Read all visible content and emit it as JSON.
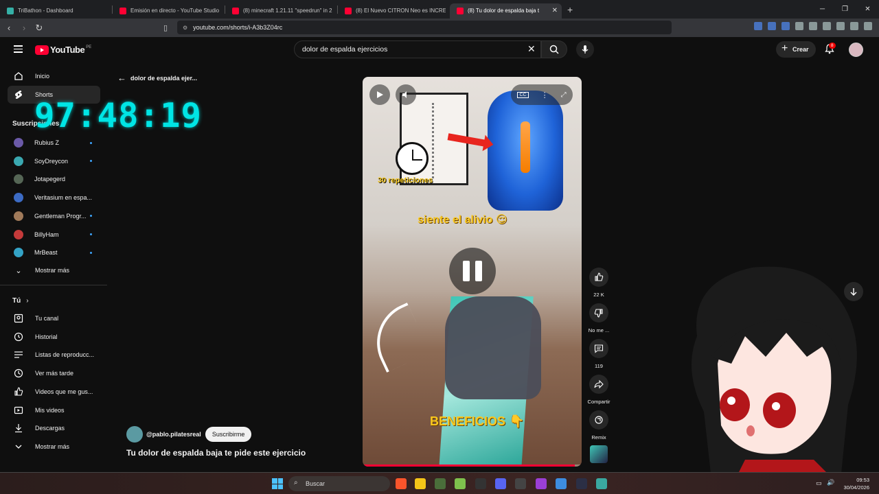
{
  "browser": {
    "tabs": [
      {
        "title": "TriBathon - Dashboard",
        "color": "#35b0a6"
      },
      {
        "title": "Emisión en directo - YouTube Studio",
        "color": "#ff0033"
      },
      {
        "title": "(8) minecraft 1.21.11 \"speedrun\" in 2",
        "color": "#ff0033"
      },
      {
        "title": "(8) El Nuevo CITRON Neo es INCREIB",
        "color": "#ff0033"
      },
      {
        "title": "(8) Tu dolor de espalda baja t",
        "color": "#ff0033",
        "active": true
      }
    ],
    "url": "youtube.com/shorts/i-A3b3Z04rc"
  },
  "header": {
    "logo_text": "YouTube",
    "country_code": "PE",
    "search_value": "dolor de espalda ejercicios",
    "create_label": "Crear",
    "notifications_count": "8"
  },
  "sidebar": {
    "main": [
      {
        "label": "Inicio",
        "icon": "home-icon"
      },
      {
        "label": "Shorts",
        "icon": "shorts-icon",
        "active": true
      }
    ],
    "subscriptions_title": "Suscripciones",
    "subscriptions": [
      {
        "label": "Rubius Z",
        "color": "#6b5aa8",
        "live_dot": true
      },
      {
        "label": "SoyDreycon",
        "color": "#3aa8b0",
        "live_dot": true
      },
      {
        "label": "Jotapegerd",
        "color": "#556655",
        "live_dot": false
      },
      {
        "label": "Veritasium en espa...",
        "color": "#3c6bc4",
        "live_dot": false
      },
      {
        "label": "Gentleman Progr...",
        "color": "#a07a5a",
        "live_dot": true
      },
      {
        "label": "BillyHam",
        "color": "#c43a3a",
        "live_dot": true
      },
      {
        "label": "MrBeast",
        "color": "#34a3c6",
        "live_dot": true
      }
    ],
    "show_more": "Mostrar más",
    "you_title": "Tú",
    "you_items": [
      {
        "label": "Tu canal",
        "icon": "channel-icon"
      },
      {
        "label": "Historial",
        "icon": "history-icon"
      },
      {
        "label": "Listas de reproducc...",
        "icon": "playlists-icon"
      },
      {
        "label": "Ver más tarde",
        "icon": "watch-later-icon"
      },
      {
        "label": "Videos que me gus...",
        "icon": "liked-icon"
      },
      {
        "label": "Mis videos",
        "icon": "my-videos-icon"
      },
      {
        "label": "Descargas",
        "icon": "downloads-icon"
      },
      {
        "label": "Mostrar más",
        "icon": "chevron-down-icon"
      }
    ]
  },
  "overlay_timer": "97:48:19",
  "shorts": {
    "back_label": "dolor de espalda ejer...",
    "channel_handle": "@pablo.pilatesreal",
    "subscribe_label": "Suscribirme",
    "title": "Tu dolor de espalda baja te pide este ejercicio",
    "video_captions": {
      "reps": "30 repeticiones",
      "relief": "siente el alivio 😌",
      "benefits": "BENEFICIOS 👇"
    },
    "progress": 0.97,
    "actions": [
      {
        "label": "22 K",
        "icon": "like-icon"
      },
      {
        "label": "No me ...",
        "icon": "dislike-icon"
      },
      {
        "label": "119",
        "icon": "comment-icon"
      },
      {
        "label": "Compartir",
        "icon": "share-icon"
      },
      {
        "label": "Remix",
        "icon": "remix-icon"
      }
    ]
  },
  "taskbar": {
    "search_placeholder": "Buscar",
    "time": "09:53",
    "date": "30/04/2026"
  }
}
